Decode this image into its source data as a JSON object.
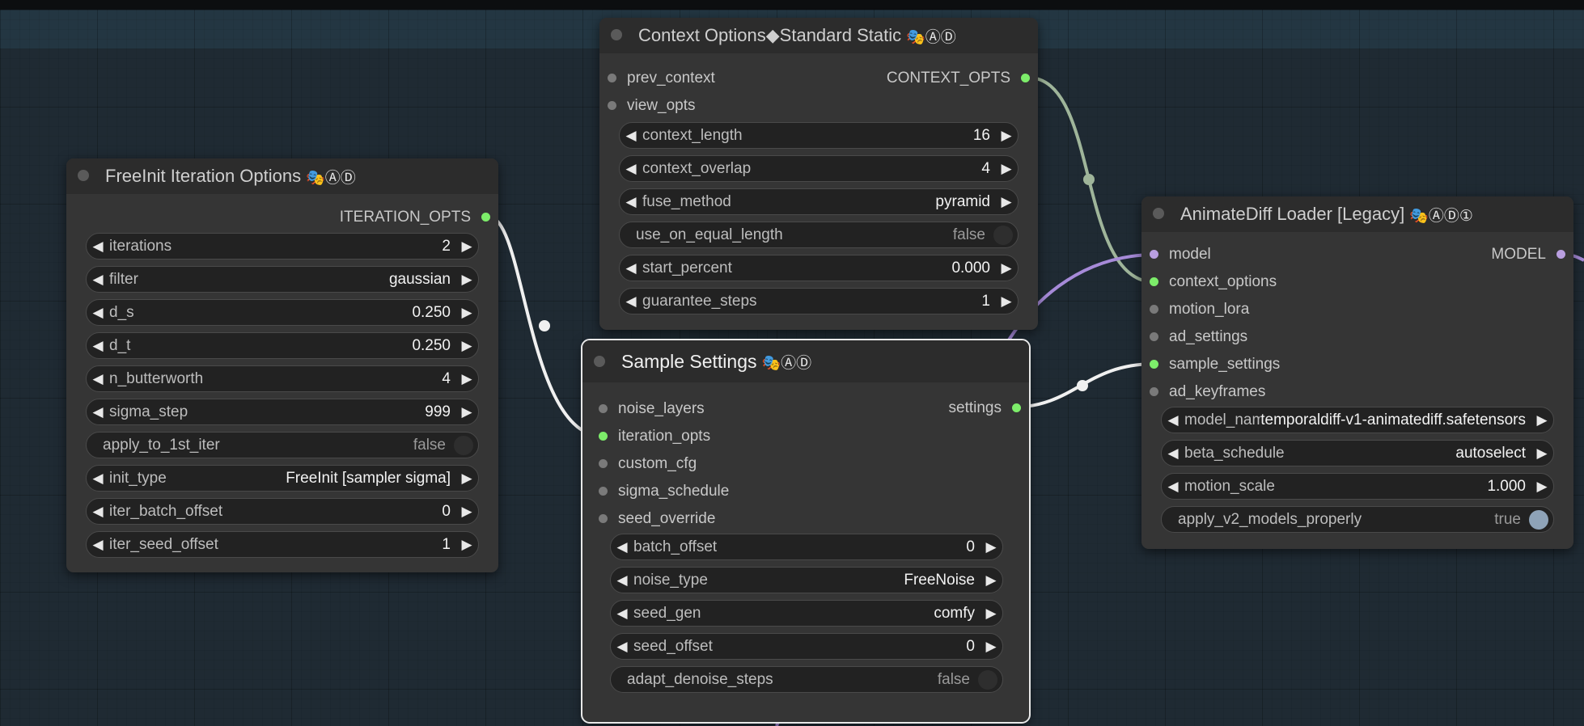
{
  "nodes": {
    "freeinit": {
      "title": "FreeInit Iteration Options",
      "badges": "🎭ⒶⒹ",
      "output": "ITERATION_OPTS",
      "widgets": [
        {
          "name": "iterations",
          "value": "2"
        },
        {
          "name": "filter",
          "value": "gaussian"
        },
        {
          "name": "d_s",
          "value": "0.250"
        },
        {
          "name": "d_t",
          "value": "0.250"
        },
        {
          "name": "n_butterworth",
          "value": "4"
        },
        {
          "name": "sigma_step",
          "value": "999"
        },
        {
          "name": "apply_to_1st_iter",
          "value": "false"
        },
        {
          "name": "init_type",
          "value": "FreeInit [sampler sigma]"
        },
        {
          "name": "iter_batch_offset",
          "value": "0"
        },
        {
          "name": "iter_seed_offset",
          "value": "1"
        }
      ]
    },
    "context": {
      "title": "Context Options◆Standard Static",
      "badges": "🎭ⒶⒹ",
      "inputs": [
        "prev_context",
        "view_opts"
      ],
      "output": "CONTEXT_OPTS",
      "widgets": [
        {
          "name": "context_length",
          "value": "16"
        },
        {
          "name": "context_overlap",
          "value": "4"
        },
        {
          "name": "fuse_method",
          "value": "pyramid"
        },
        {
          "name": "use_on_equal_length",
          "value": "false"
        },
        {
          "name": "start_percent",
          "value": "0.000"
        },
        {
          "name": "guarantee_steps",
          "value": "1"
        }
      ]
    },
    "sample": {
      "title": "Sample Settings",
      "badges": "🎭ⒶⒹ",
      "inputs": [
        "noise_layers",
        "iteration_opts",
        "custom_cfg",
        "sigma_schedule",
        "seed_override"
      ],
      "output": "settings",
      "widgets": [
        {
          "name": "batch_offset",
          "value": "0"
        },
        {
          "name": "noise_type",
          "value": "FreeNoise"
        },
        {
          "name": "seed_gen",
          "value": "comfy"
        },
        {
          "name": "seed_offset",
          "value": "0"
        },
        {
          "name": "adapt_denoise_steps",
          "value": "false"
        }
      ]
    },
    "loader": {
      "title": "AnimateDiff Loader [Legacy]",
      "badges": "🎭ⒶⒹ①",
      "inputs": [
        "model",
        "context_options",
        "motion_lora",
        "ad_settings",
        "sample_settings",
        "ad_keyframes"
      ],
      "output": "MODEL",
      "widgets": [
        {
          "name": "model_name",
          "value": "temporaldiff-v1-animatediff.safetensors"
        },
        {
          "name": "beta_schedule",
          "value": "autoselect"
        },
        {
          "name": "motion_scale",
          "value": "1.000"
        },
        {
          "name": "apply_v2_models_properly",
          "value": "true"
        }
      ]
    }
  },
  "colors": {
    "link_green": "#9fb59a",
    "link_white": "#f0f0f0",
    "link_purple": "#a68ad8",
    "slot_connected": "#7ded6a",
    "canvas": "#1f2a33"
  }
}
